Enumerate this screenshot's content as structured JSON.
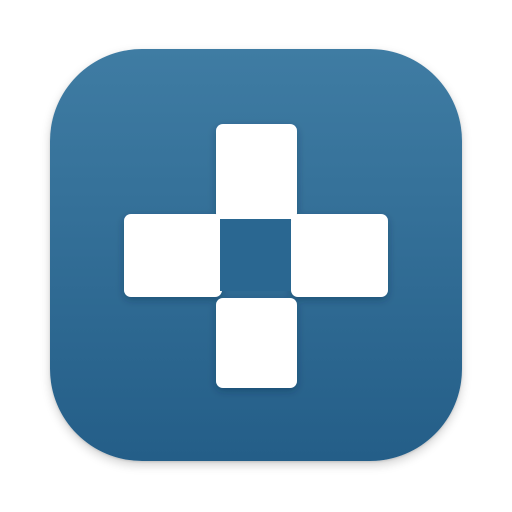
{
  "icon": {
    "name": "cross-app-icon",
    "symbol": "cross-with-center-hole",
    "colors": {
      "background_top": "#3F7CA3",
      "background_bottom": "#245E88",
      "symbol": "#FFFFFF",
      "center_square": "#2A6791"
    }
  }
}
